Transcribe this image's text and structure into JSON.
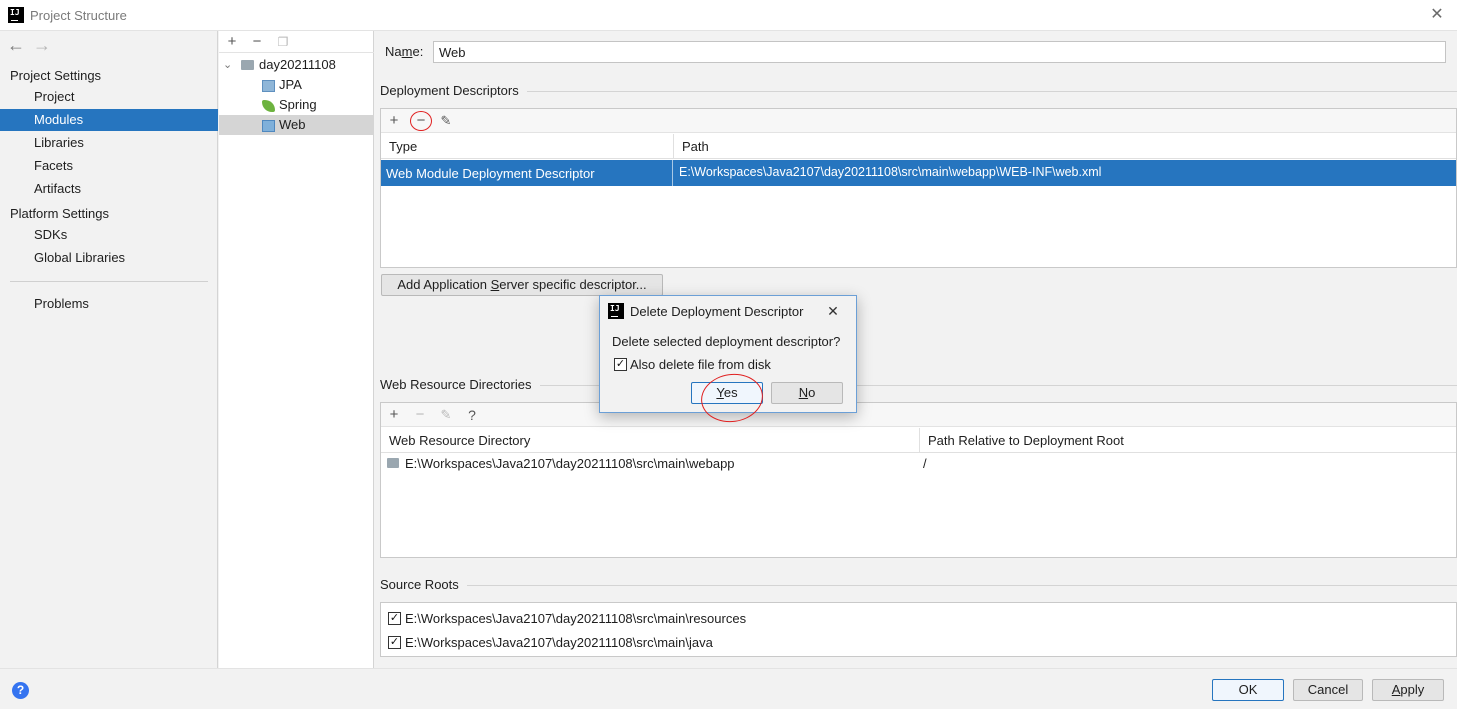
{
  "window": {
    "title": "Project Structure"
  },
  "sidebar": {
    "project_settings_header": "Project Settings",
    "project_settings_items": [
      "Project",
      "Modules",
      "Libraries",
      "Facets",
      "Artifacts"
    ],
    "selected_item": "Modules",
    "platform_settings_header": "Platform Settings",
    "platform_settings_items": [
      "SDKs",
      "Global Libraries"
    ],
    "problems": "Problems"
  },
  "tree": {
    "root": "day20211108",
    "children": [
      "JPA",
      "Spring",
      "Web"
    ],
    "selected": "Web"
  },
  "main": {
    "name_label_prefix": "Na",
    "name_label_mnemonic": "m",
    "name_label_suffix": "e:",
    "name_value": "Web",
    "deployment_descriptors": {
      "title": "Deployment Descriptors",
      "columns": [
        "Type",
        "Path"
      ],
      "rows": [
        {
          "type": "Web Module Deployment Descriptor",
          "path": "E:\\Workspaces\\Java2107\\day20211108\\src\\main\\webapp\\WEB-INF\\web.xml"
        }
      ],
      "add_server_btn_prefix": "Add Application ",
      "add_server_btn_mnemonic": "S",
      "add_server_btn_suffix": "erver specific descriptor..."
    },
    "web_resources": {
      "title": "Web Resource Directories",
      "columns": [
        "Web Resource Directory",
        "Path Relative to Deployment Root"
      ],
      "rows": [
        {
          "directory": "E:\\Workspaces\\Java2107\\day20211108\\src\\main\\webapp",
          "relative": "/"
        }
      ]
    },
    "source_roots": {
      "title": "Source Roots",
      "items": [
        "E:\\Workspaces\\Java2107\\day20211108\\src\\main\\resources",
        "E:\\Workspaces\\Java2107\\day20211108\\src\\main\\java"
      ]
    }
  },
  "dialog": {
    "title": "Delete Deployment Descriptor",
    "message": "Delete selected deployment descriptor?",
    "checkbox_label": "Also delete file from disk",
    "checkbox_checked": true,
    "yes_mnemonic": "Y",
    "yes_rest": "es",
    "no_mnemonic": "N",
    "no_rest": "o"
  },
  "footer": {
    "ok": "OK",
    "cancel": "Cancel",
    "apply_mnemonic": "A",
    "apply_rest": "pply",
    "help_glyph": "?"
  },
  "icons": {
    "back": "arrow-left-icon",
    "forward": "arrow-right-icon",
    "add": "plus-icon",
    "remove": "minus-icon",
    "copy": "copy-icon",
    "edit": "pencil-icon",
    "help": "question-icon"
  },
  "colors": {
    "selection": "#2675bf",
    "accent_border": "#6b9fd6",
    "annotation": "#e02020"
  }
}
